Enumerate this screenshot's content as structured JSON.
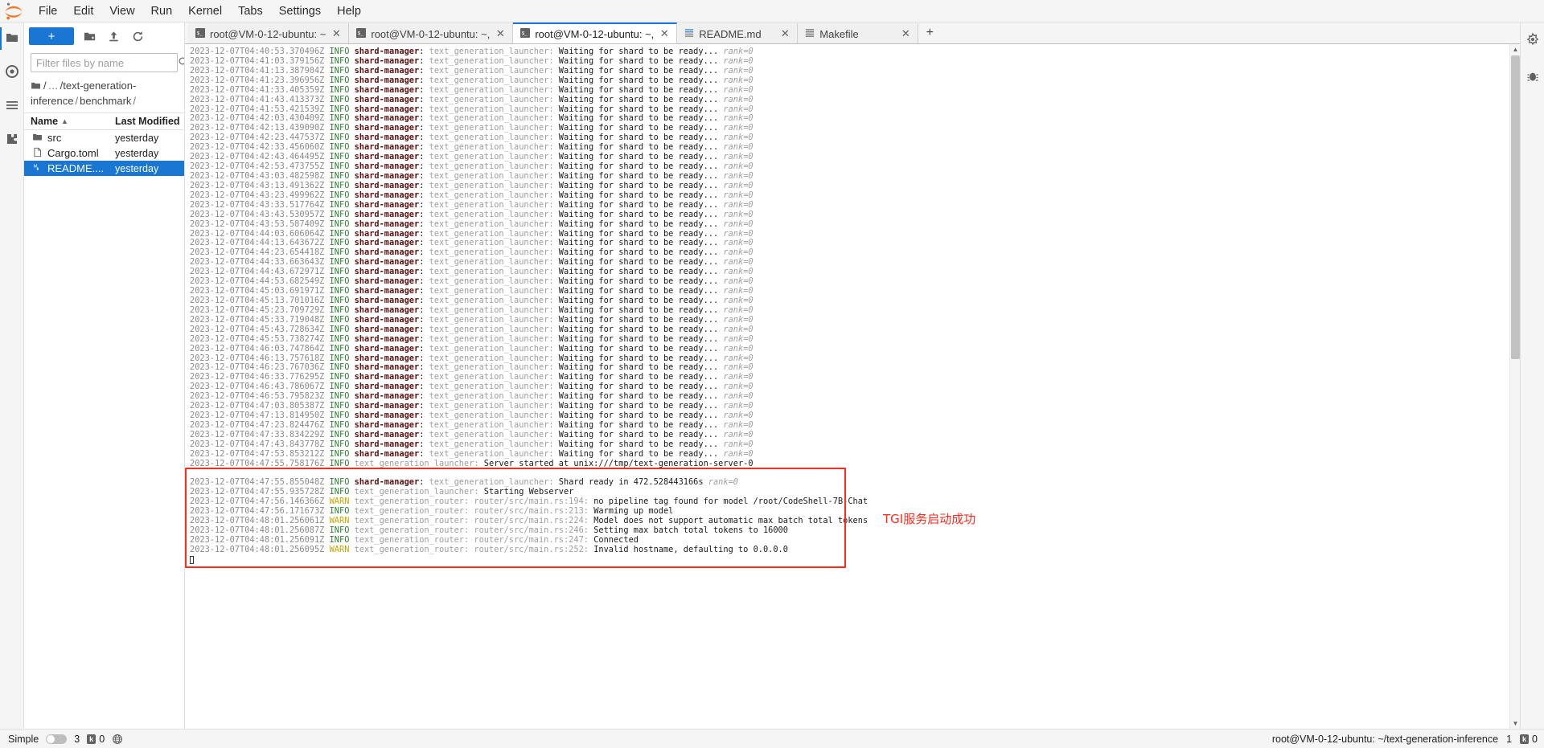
{
  "menubar": {
    "logo_icon": "jupyter-logo-icon",
    "items": [
      "File",
      "Edit",
      "View",
      "Run",
      "Kernel",
      "Tabs",
      "Settings",
      "Help"
    ]
  },
  "left_rail": {
    "items": [
      {
        "icon": "folder-icon",
        "name": "file-browser"
      },
      {
        "icon": "running-terminals-icon",
        "name": "running-kernels"
      },
      {
        "icon": "commands-list-icon",
        "name": "commands-palette"
      },
      {
        "icon": "extension-puzzle-icon",
        "name": "extension-manager"
      }
    ]
  },
  "right_rail": {
    "items": [
      {
        "icon": "property-inspector-icon",
        "name": "property-inspector"
      },
      {
        "icon": "debugger-bug-icon",
        "name": "debugger"
      }
    ]
  },
  "filebrowser": {
    "new_launcher_label": "+",
    "toolbar_icons": [
      "new-folder-icon",
      "upload-icon",
      "refresh-icon"
    ],
    "filter": {
      "placeholder": "Filter files by name",
      "value": "",
      "icon": "search-icon"
    },
    "breadcrumb": {
      "home_icon": "folder-icon",
      "parts": [
        "/",
        "…",
        "/",
        "text-generation-inference",
        "/",
        "benchmark",
        "/"
      ]
    },
    "columns": {
      "name": "Name",
      "last_modified": "Last Modified",
      "sort_caret": "▲"
    },
    "rows": [
      {
        "icon": "folder-icon",
        "name": "src",
        "modified": "yesterday",
        "selected": false
      },
      {
        "icon": "file-icon",
        "name": "Cargo.toml",
        "modified": "yesterday",
        "selected": false
      },
      {
        "icon": "markdown-icon",
        "name": "README....",
        "modified": "yesterday",
        "selected": true
      }
    ]
  },
  "tabs": [
    {
      "icon": "terminal-icon",
      "label": "root@VM-0-12-ubuntu: ~",
      "close": "✕",
      "active": false
    },
    {
      "icon": "terminal-icon",
      "label": "root@VM-0-12-ubuntu: ~,",
      "close": "✕",
      "active": false
    },
    {
      "icon": "terminal-icon",
      "label": "root@VM-0-12-ubuntu: ~,",
      "close": "✕",
      "active": true
    },
    {
      "icon": "markdown-file-icon",
      "label": "README.md",
      "close": "✕",
      "active": false
    },
    {
      "icon": "text-file-icon",
      "label": "Makefile",
      "close": "✕",
      "active": false
    }
  ],
  "tab_add_label": "+",
  "terminal": {
    "lines": [
      {
        "ts": "2023-12-07T04:40:53.370496Z",
        "lvl": "INFO",
        "tgt": "shard-manager",
        "mod": "text_generation_launcher:",
        "msg": "Waiting for shard to be ready...",
        "rank": "rank=0"
      },
      {
        "ts": "2023-12-07T04:41:03.379156Z",
        "lvl": "INFO",
        "tgt": "shard-manager",
        "mod": "text_generation_launcher:",
        "msg": "Waiting for shard to be ready...",
        "rank": "rank=0"
      },
      {
        "ts": "2023-12-07T04:41:13.387904Z",
        "lvl": "INFO",
        "tgt": "shard-manager",
        "mod": "text_generation_launcher:",
        "msg": "Waiting for shard to be ready...",
        "rank": "rank=0"
      },
      {
        "ts": "2023-12-07T04:41:23.396956Z",
        "lvl": "INFO",
        "tgt": "shard-manager",
        "mod": "text_generation_launcher:",
        "msg": "Waiting for shard to be ready...",
        "rank": "rank=0"
      },
      {
        "ts": "2023-12-07T04:41:33.405359Z",
        "lvl": "INFO",
        "tgt": "shard-manager",
        "mod": "text_generation_launcher:",
        "msg": "Waiting for shard to be ready...",
        "rank": "rank=0"
      },
      {
        "ts": "2023-12-07T04:41:43.413373Z",
        "lvl": "INFO",
        "tgt": "shard-manager",
        "mod": "text_generation_launcher:",
        "msg": "Waiting for shard to be ready...",
        "rank": "rank=0"
      },
      {
        "ts": "2023-12-07T04:41:53.421539Z",
        "lvl": "INFO",
        "tgt": "shard-manager",
        "mod": "text_generation_launcher:",
        "msg": "Waiting for shard to be ready...",
        "rank": "rank=0"
      },
      {
        "ts": "2023-12-07T04:42:03.430409Z",
        "lvl": "INFO",
        "tgt": "shard-manager",
        "mod": "text_generation_launcher:",
        "msg": "Waiting for shard to be ready...",
        "rank": "rank=0"
      },
      {
        "ts": "2023-12-07T04:42:13.439090Z",
        "lvl": "INFO",
        "tgt": "shard-manager",
        "mod": "text_generation_launcher:",
        "msg": "Waiting for shard to be ready...",
        "rank": "rank=0"
      },
      {
        "ts": "2023-12-07T04:42:23.447537Z",
        "lvl": "INFO",
        "tgt": "shard-manager",
        "mod": "text_generation_launcher:",
        "msg": "Waiting for shard to be ready...",
        "rank": "rank=0"
      },
      {
        "ts": "2023-12-07T04:42:33.456060Z",
        "lvl": "INFO",
        "tgt": "shard-manager",
        "mod": "text_generation_launcher:",
        "msg": "Waiting for shard to be ready...",
        "rank": "rank=0"
      },
      {
        "ts": "2023-12-07T04:42:43.464495Z",
        "lvl": "INFO",
        "tgt": "shard-manager",
        "mod": "text_generation_launcher:",
        "msg": "Waiting for shard to be ready...",
        "rank": "rank=0"
      },
      {
        "ts": "2023-12-07T04:42:53.473755Z",
        "lvl": "INFO",
        "tgt": "shard-manager",
        "mod": "text_generation_launcher:",
        "msg": "Waiting for shard to be ready...",
        "rank": "rank=0"
      },
      {
        "ts": "2023-12-07T04:43:03.482598Z",
        "lvl": "INFO",
        "tgt": "shard-manager",
        "mod": "text_generation_launcher:",
        "msg": "Waiting for shard to be ready...",
        "rank": "rank=0"
      },
      {
        "ts": "2023-12-07T04:43:13.491362Z",
        "lvl": "INFO",
        "tgt": "shard-manager",
        "mod": "text_generation_launcher:",
        "msg": "Waiting for shard to be ready...",
        "rank": "rank=0"
      },
      {
        "ts": "2023-12-07T04:43:23.499962Z",
        "lvl": "INFO",
        "tgt": "shard-manager",
        "mod": "text_generation_launcher:",
        "msg": "Waiting for shard to be ready...",
        "rank": "rank=0"
      },
      {
        "ts": "2023-12-07T04:43:33.517764Z",
        "lvl": "INFO",
        "tgt": "shard-manager",
        "mod": "text_generation_launcher:",
        "msg": "Waiting for shard to be ready...",
        "rank": "rank=0"
      },
      {
        "ts": "2023-12-07T04:43:43.530957Z",
        "lvl": "INFO",
        "tgt": "shard-manager",
        "mod": "text_generation_launcher:",
        "msg": "Waiting for shard to be ready...",
        "rank": "rank=0"
      },
      {
        "ts": "2023-12-07T04:43:53.587409Z",
        "lvl": "INFO",
        "tgt": "shard-manager",
        "mod": "text_generation_launcher:",
        "msg": "Waiting for shard to be ready...",
        "rank": "rank=0"
      },
      {
        "ts": "2023-12-07T04:44:03.606064Z",
        "lvl": "INFO",
        "tgt": "shard-manager",
        "mod": "text_generation_launcher:",
        "msg": "Waiting for shard to be ready...",
        "rank": "rank=0"
      },
      {
        "ts": "2023-12-07T04:44:13.643672Z",
        "lvl": "INFO",
        "tgt": "shard-manager",
        "mod": "text_generation_launcher:",
        "msg": "Waiting for shard to be ready...",
        "rank": "rank=0"
      },
      {
        "ts": "2023-12-07T04:44:23.654418Z",
        "lvl": "INFO",
        "tgt": "shard-manager",
        "mod": "text_generation_launcher:",
        "msg": "Waiting for shard to be ready...",
        "rank": "rank=0"
      },
      {
        "ts": "2023-12-07T04:44:33.663643Z",
        "lvl": "INFO",
        "tgt": "shard-manager",
        "mod": "text_generation_launcher:",
        "msg": "Waiting for shard to be ready...",
        "rank": "rank=0"
      },
      {
        "ts": "2023-12-07T04:44:43.672971Z",
        "lvl": "INFO",
        "tgt": "shard-manager",
        "mod": "text_generation_launcher:",
        "msg": "Waiting for shard to be ready...",
        "rank": "rank=0"
      },
      {
        "ts": "2023-12-07T04:44:53.682549Z",
        "lvl": "INFO",
        "tgt": "shard-manager",
        "mod": "text_generation_launcher:",
        "msg": "Waiting for shard to be ready...",
        "rank": "rank=0"
      },
      {
        "ts": "2023-12-07T04:45:03.691971Z",
        "lvl": "INFO",
        "tgt": "shard-manager",
        "mod": "text_generation_launcher:",
        "msg": "Waiting for shard to be ready...",
        "rank": "rank=0"
      },
      {
        "ts": "2023-12-07T04:45:13.701016Z",
        "lvl": "INFO",
        "tgt": "shard-manager",
        "mod": "text_generation_launcher:",
        "msg": "Waiting for shard to be ready...",
        "rank": "rank=0"
      },
      {
        "ts": "2023-12-07T04:45:23.709729Z",
        "lvl": "INFO",
        "tgt": "shard-manager",
        "mod": "text_generation_launcher:",
        "msg": "Waiting for shard to be ready...",
        "rank": "rank=0"
      },
      {
        "ts": "2023-12-07T04:45:33.719048Z",
        "lvl": "INFO",
        "tgt": "shard-manager",
        "mod": "text_generation_launcher:",
        "msg": "Waiting for shard to be ready...",
        "rank": "rank=0"
      },
      {
        "ts": "2023-12-07T04:45:43.728634Z",
        "lvl": "INFO",
        "tgt": "shard-manager",
        "mod": "text_generation_launcher:",
        "msg": "Waiting for shard to be ready...",
        "rank": "rank=0"
      },
      {
        "ts": "2023-12-07T04:45:53.738274Z",
        "lvl": "INFO",
        "tgt": "shard-manager",
        "mod": "text_generation_launcher:",
        "msg": "Waiting for shard to be ready...",
        "rank": "rank=0"
      },
      {
        "ts": "2023-12-07T04:46:03.747864Z",
        "lvl": "INFO",
        "tgt": "shard-manager",
        "mod": "text_generation_launcher:",
        "msg": "Waiting for shard to be ready...",
        "rank": "rank=0"
      },
      {
        "ts": "2023-12-07T04:46:13.757618Z",
        "lvl": "INFO",
        "tgt": "shard-manager",
        "mod": "text_generation_launcher:",
        "msg": "Waiting for shard to be ready...",
        "rank": "rank=0"
      },
      {
        "ts": "2023-12-07T04:46:23.767036Z",
        "lvl": "INFO",
        "tgt": "shard-manager",
        "mod": "text_generation_launcher:",
        "msg": "Waiting for shard to be ready...",
        "rank": "rank=0"
      },
      {
        "ts": "2023-12-07T04:46:33.776295Z",
        "lvl": "INFO",
        "tgt": "shard-manager",
        "mod": "text_generation_launcher:",
        "msg": "Waiting for shard to be ready...",
        "rank": "rank=0"
      },
      {
        "ts": "2023-12-07T04:46:43.786067Z",
        "lvl": "INFO",
        "tgt": "shard-manager",
        "mod": "text_generation_launcher:",
        "msg": "Waiting for shard to be ready...",
        "rank": "rank=0"
      },
      {
        "ts": "2023-12-07T04:46:53.795823Z",
        "lvl": "INFO",
        "tgt": "shard-manager",
        "mod": "text_generation_launcher:",
        "msg": "Waiting for shard to be ready...",
        "rank": "rank=0"
      },
      {
        "ts": "2023-12-07T04:47:03.805387Z",
        "lvl": "INFO",
        "tgt": "shard-manager",
        "mod": "text_generation_launcher:",
        "msg": "Waiting for shard to be ready...",
        "rank": "rank=0"
      },
      {
        "ts": "2023-12-07T04:47:13.814950Z",
        "lvl": "INFO",
        "tgt": "shard-manager",
        "mod": "text_generation_launcher:",
        "msg": "Waiting for shard to be ready...",
        "rank": "rank=0"
      },
      {
        "ts": "2023-12-07T04:47:23.824476Z",
        "lvl": "INFO",
        "tgt": "shard-manager",
        "mod": "text_generation_launcher:",
        "msg": "Waiting for shard to be ready...",
        "rank": "rank=0"
      },
      {
        "ts": "2023-12-07T04:47:33.834229Z",
        "lvl": "INFO",
        "tgt": "shard-manager",
        "mod": "text_generation_launcher:",
        "msg": "Waiting for shard to be ready...",
        "rank": "rank=0"
      },
      {
        "ts": "2023-12-07T04:47:43.843778Z",
        "lvl": "INFO",
        "tgt": "shard-manager",
        "mod": "text_generation_launcher:",
        "msg": "Waiting for shard to be ready...",
        "rank": "rank=0"
      },
      {
        "ts": "2023-12-07T04:47:53.853212Z",
        "lvl": "INFO",
        "tgt": "shard-manager",
        "mod": "text_generation_launcher:",
        "msg": "Waiting for shard to be ready...",
        "rank": "rank=0"
      },
      {
        "ts": "2023-12-07T04:47:55.758176Z",
        "lvl": "INFO",
        "tgt": "",
        "mod": "text_generation_launcher:",
        "msg": "Server started at unix:///tmp/text-generation-server-0",
        "rank": ""
      },
      {
        "ts": "",
        "lvl": "",
        "tgt": "",
        "mod": "",
        "msg": "",
        "rank": ""
      },
      {
        "ts": "2023-12-07T04:47:55.855048Z",
        "lvl": "INFO",
        "tgt": "shard-manager",
        "mod": "text_generation_launcher:",
        "msg": "Shard ready in 472.528443166s",
        "rank": "rank=0"
      },
      {
        "ts": "2023-12-07T04:47:55.935728Z",
        "lvl": "INFO",
        "tgt": "",
        "mod": "text_generation_launcher:",
        "msg": "Starting Webserver",
        "rank": ""
      },
      {
        "ts": "2023-12-07T04:47:56.146366Z",
        "lvl": "WARN",
        "tgt": "",
        "mod": "text_generation_router: router/src/main.rs:194:",
        "msg": "no pipeline tag found for model /root/CodeShell-7B-Chat",
        "rank": ""
      },
      {
        "ts": "2023-12-07T04:47:56.171673Z",
        "lvl": "INFO",
        "tgt": "",
        "mod": "text_generation_router: router/src/main.rs:213:",
        "msg": "Warming up model",
        "rank": ""
      },
      {
        "ts": "2023-12-07T04:48:01.256061Z",
        "lvl": "WARN",
        "tgt": "",
        "mod": "text_generation_router: router/src/main.rs:224:",
        "msg": "Model does not support automatic max batch total tokens",
        "rank": ""
      },
      {
        "ts": "2023-12-07T04:48:01.256087Z",
        "lvl": "INFO",
        "tgt": "",
        "mod": "text_generation_router: router/src/main.rs:246:",
        "msg": "Setting max batch total tokens to 16000",
        "rank": ""
      },
      {
        "ts": "2023-12-07T04:48:01.256091Z",
        "lvl": "INFO",
        "tgt": "",
        "mod": "text_generation_router: router/src/main.rs:247:",
        "msg": "Connected",
        "rank": ""
      },
      {
        "ts": "2023-12-07T04:48:01.256095Z",
        "lvl": "WARN",
        "tgt": "",
        "mod": "text_generation_router: router/src/main.rs:252:",
        "msg": "Invalid hostname, defaulting to 0.0.0.0",
        "rank": ""
      }
    ],
    "annotation": "TGI服务启动成功",
    "annotation_color": "#ff2b1c",
    "highlight_box_color": "#ff2b1c"
  },
  "statusbar": {
    "mode_label": "Simple",
    "terminals_count": "3",
    "kernel_badge": "k",
    "kernels_count": "0",
    "globe_icon": "globe-icon",
    "right_title": "root@VM-0-12-ubuntu: ~/text-generation-inference",
    "right_counts": "1",
    "right_badge_icon": "kernel-badge-icon",
    "right_count2": "0"
  }
}
